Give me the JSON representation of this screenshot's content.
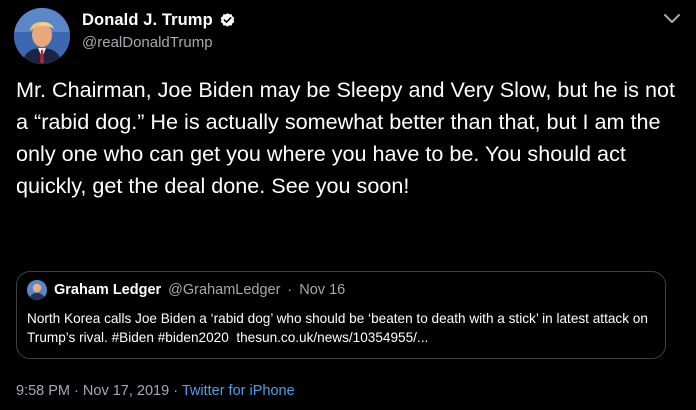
{
  "tweet": {
    "author": {
      "display_name": "Donald J. Trump",
      "handle": "@realDonaldTrump",
      "verified": true,
      "avatar_icon": "profile-photo",
      "verified_icon": "verified-badge-icon"
    },
    "text": "Mr. Chairman, Joe Biden may be Sleepy and Very Slow, but he is not a “rabid dog.” He is actually somewhat better than that, but I am the only one who can get you where you have to be. You should act quickly, get the deal done. See you soon!",
    "quoted": {
      "display_name": "Graham Ledger",
      "handle": "@GrahamLedger",
      "separator": "·",
      "date": "Nov 16",
      "text": "North Korea calls Joe Biden a ‘rabid dog’ who should be ‘beaten to death with a stick’ in latest attack on Trump’s rival. #Biden #biden2020  thesun.co.uk/news/10354955/..."
    },
    "meta": {
      "time": "9:58 PM",
      "separator": "·",
      "date": "Nov 17, 2019",
      "source": "Twitter for iPhone"
    },
    "menu_icon": "chevron-down-icon"
  },
  "colors": {
    "background": "#000000",
    "primary_text": "#ffffff",
    "secondary_text": "#a3aab0",
    "link": "#4aa0ea",
    "verified": "#ffffff",
    "border": "#3d4145"
  }
}
